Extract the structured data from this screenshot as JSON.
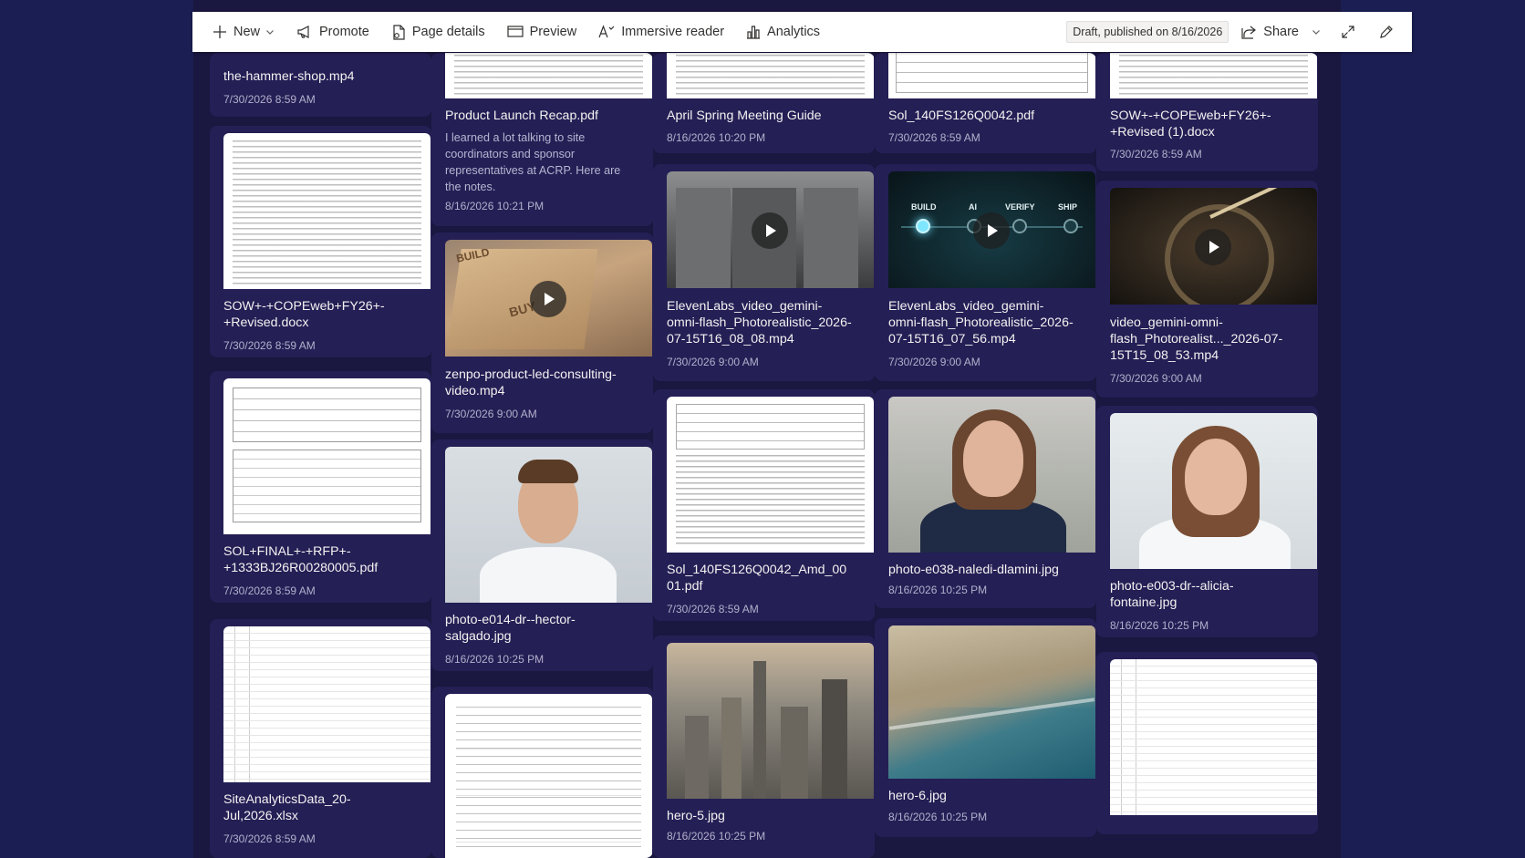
{
  "toolbar": {
    "new_label": "New",
    "promote_label": "Promote",
    "page_details_label": "Page details",
    "preview_label": "Preview",
    "immersive_reader_label": "Immersive reader",
    "analytics_label": "Analytics",
    "status": "Draft, published on 8/16/2026",
    "share_label": "Share"
  },
  "pipeline_labels": [
    "BUILD",
    "AI",
    "VERIFY",
    "SHIP"
  ],
  "build_box_labels": [
    "BUILD",
    "BUY"
  ],
  "columns": [
    {
      "cards": [
        {
          "title": "the-hammer-shop.mp4",
          "date": "7/30/2026 8:59 AM"
        },
        {
          "title": "SOW+-+COPEweb+FY26+-+Revised.docx",
          "date": "7/30/2026 8:59 AM"
        },
        {
          "title": "SOL+FINAL+-+RFP+-+1333BJ26R00280005.pdf",
          "date": "7/30/2026 8:59 AM"
        },
        {
          "title": "SiteAnalyticsData_20-Jul,2026.xlsx",
          "date": "7/30/2026 8:59 AM"
        }
      ]
    },
    {
      "cards": [
        {
          "title": "Product Launch Recap.pdf",
          "description": "I learned a lot talking to site coordinators and sponsor representatives at ACRP. Here are the notes.",
          "date": "8/16/2026 10:21 PM"
        },
        {
          "title": "zenpo-product-led-consulting-video.mp4",
          "date": "7/30/2026 9:00 AM"
        },
        {
          "title": "photo-e014-dr--hector-salgado.jpg",
          "date": "8/16/2026 10:25 PM"
        },
        {
          "title": "",
          "date": ""
        }
      ]
    },
    {
      "cards": [
        {
          "title": "April Spring Meeting Guide",
          "date": "8/16/2026 10:20 PM"
        },
        {
          "title": "ElevenLabs_video_gemini-omni-flash_Photorealistic_2026-07-15T16_08_08.mp4",
          "date": "7/30/2026 9:00 AM"
        },
        {
          "title": "Sol_140FS126Q0042_Amd_0001.pdf",
          "date": "7/30/2026 8:59 AM"
        },
        {
          "title": "hero-5.jpg",
          "date": "8/16/2026 10:25 PM"
        }
      ]
    },
    {
      "cards": [
        {
          "title": "Sol_140FS126Q0042.pdf",
          "date": "7/30/2026 8:59 AM"
        },
        {
          "title": "ElevenLabs_video_gemini-omni-flash_Photorealistic_2026-07-15T16_07_56.mp4",
          "date": "7/30/2026 9:00 AM"
        },
        {
          "title": "photo-e038-naledi-dlamini.jpg",
          "date": "8/16/2026 10:25 PM"
        },
        {
          "title": "hero-6.jpg",
          "date": "8/16/2026 10:25 PM"
        }
      ]
    },
    {
      "cards": [
        {
          "title": "SOW+-+COPEweb+FY26+-+Revised (1).docx",
          "date": "7/30/2026 8:59 AM"
        },
        {
          "title": "video_gemini-omni-flash_Photorealist..._2026-07-15T15_08_53.mp4",
          "date": "7/30/2026 9:00 AM"
        },
        {
          "title": "photo-e003-dr--alicia-fontaine.jpg",
          "date": "8/16/2026 10:25 PM"
        },
        {
          "title": "",
          "date": ""
        }
      ]
    }
  ]
}
